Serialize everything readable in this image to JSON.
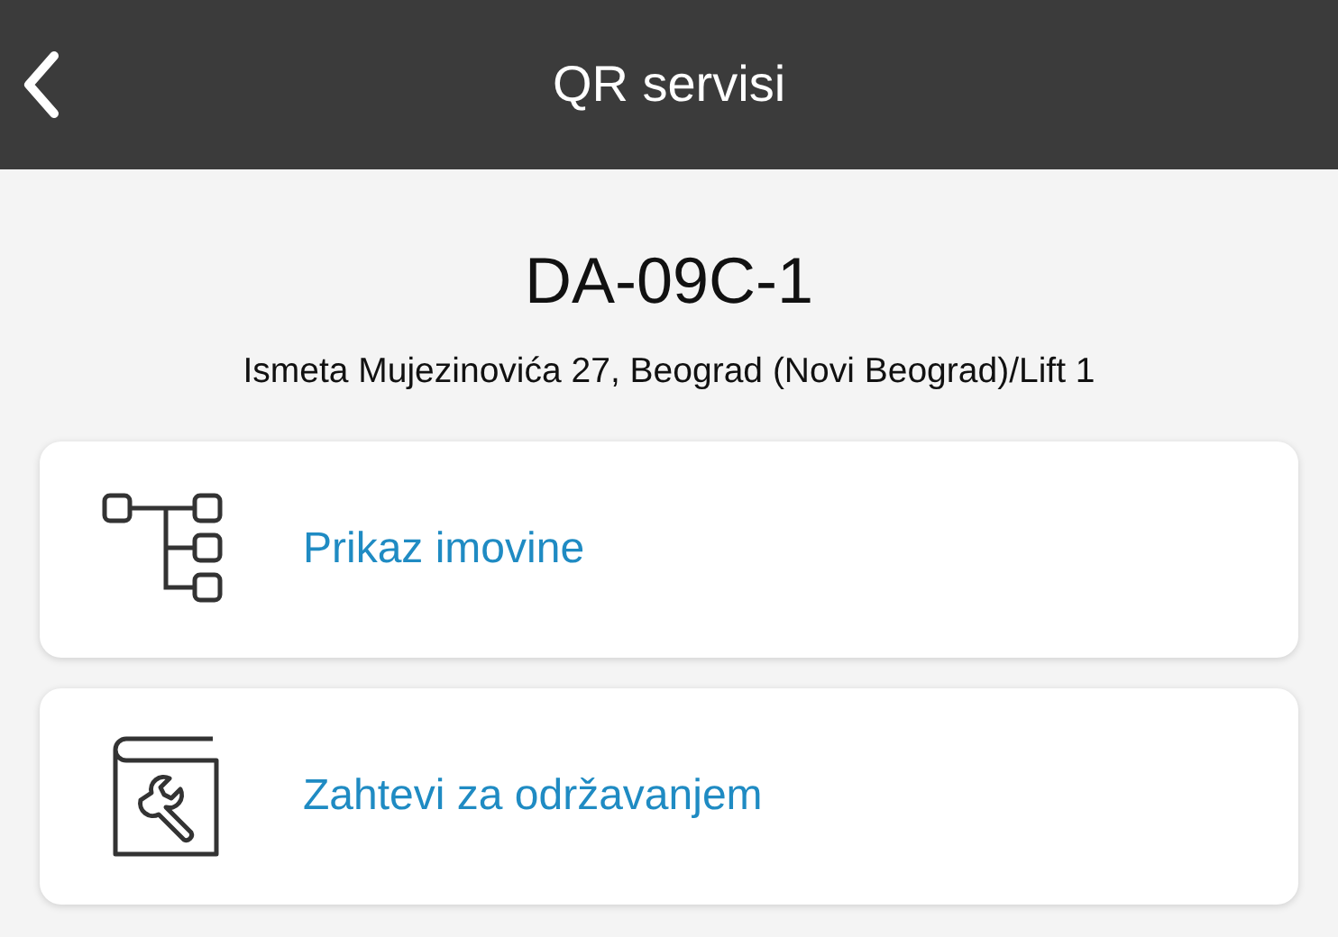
{
  "header": {
    "title": "QR servisi"
  },
  "device": {
    "code": "DA-09C-1",
    "address": "Ismeta Mujezinovića 27, Beograd (Novi Beograd)/Lift 1"
  },
  "services": [
    {
      "kind": "tree",
      "label": "Prikaz imovine"
    },
    {
      "kind": "maintenance",
      "label": "Zahtevi za održavanjem"
    }
  ]
}
